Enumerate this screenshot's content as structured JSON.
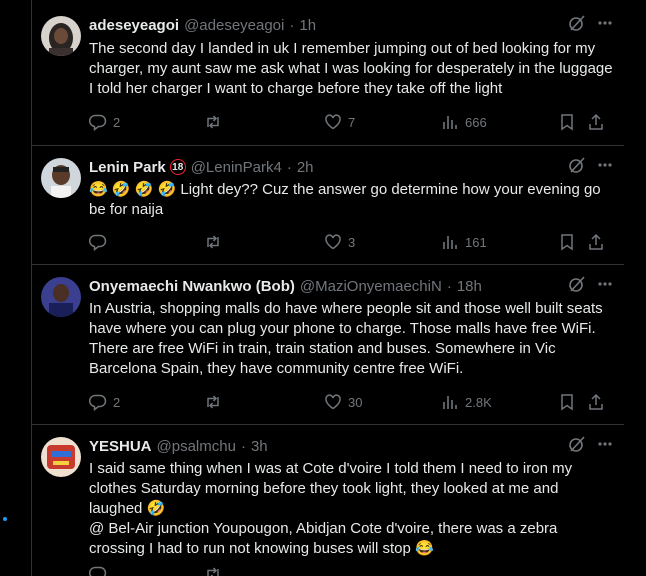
{
  "tweets": [
    {
      "name": "adeseyeagoi",
      "handle": "@adeseyeagoi",
      "sep": "·",
      "time": "1h",
      "badge": "",
      "text": "The second day I landed in uk I remember jumping out of bed looking for my charger, my aunt saw me ask what I was looking for desperately in the luggage I told her charger I want to charge before they take off the light",
      "replies": "2",
      "retweets": "",
      "likes": "7",
      "views": "666"
    },
    {
      "name": "Lenin Park",
      "handle": "@LeninPark4",
      "sep": "·",
      "time": "2h",
      "badge": "18",
      "text": "😂 🤣 🤣 🤣 Light dey?? Cuz the answer go determine how your evening go be for naija",
      "replies": "",
      "retweets": "",
      "likes": "3",
      "views": "161"
    },
    {
      "name": "Onyemaechi Nwankwo (Bob)",
      "handle": "@MaziOnyemaechiN",
      "sep": "·",
      "time": "18h",
      "badge": "",
      "text": "In Austria, shopping malls do have where people sit and those well built seats have where you can plug your phone to charge. Those malls have free WiFi. There are free WiFi in train, train station and buses. Somewhere in Vic Barcelona Spain, they have community centre free WiFi.",
      "replies": "2",
      "retweets": "",
      "likes": "30",
      "views": "2.8K"
    },
    {
      "name": "YESHUA",
      "handle": "@psalmchu",
      "sep": "·",
      "time": "3h",
      "badge": "",
      "text": "I said same thing when I was at Cote d'voire I told them I need to iron my clothes Saturday morning before they took light, they looked at me and laughed 🤣\n@ Bel-Air junction Youpougon, Abidjan Cote d'voire, there was a zebra crossing I had to run not knowing buses will stop 😂",
      "replies": "",
      "retweets": "",
      "likes": "",
      "views": ""
    }
  ],
  "colors": {
    "background": "#000000",
    "text": "#e7e9ea",
    "muted": "#71767b",
    "border": "#2f3336",
    "accent": "#1d9bf0"
  },
  "icons": [
    "grok-icon",
    "more-icon",
    "reply-icon",
    "retweet-icon",
    "like-icon",
    "views-icon",
    "bookmark-icon",
    "share-icon"
  ]
}
